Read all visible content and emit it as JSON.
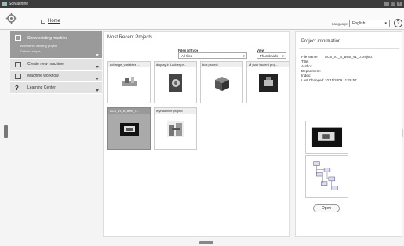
{
  "app": {
    "title": "SoMachine"
  },
  "toolbar": {
    "home_label": "Home",
    "language_label": "Language:",
    "language_value": "English",
    "help_label": "?"
  },
  "sidebar": {
    "active": {
      "label": "Show existing machine",
      "sub1": "Browse for existing project",
      "sub2": "Detect sample"
    },
    "items": [
      {
        "label": "Create new machine"
      },
      {
        "label": "Machine workflow"
      },
      {
        "label": "Learning Center"
      }
    ]
  },
  "main": {
    "heading": "Most Recent Projects",
    "files_label": "Files of type",
    "files_value": "All files",
    "view_label": "View",
    "view_value": "Thumbnails",
    "tiles": [
      {
        "label": "echange_variables ..."
      },
      {
        "label": "display in Ladder pr..."
      },
      {
        "label": "box project"
      },
      {
        "label": "M pour laurent proj..."
      },
      {
        "label": "ACS_v1_B_Best_v..."
      },
      {
        "label": "mymachine project"
      }
    ]
  },
  "info": {
    "title": "Project Information",
    "rows": [
      {
        "k": "File Name:",
        "v": "ACS_v1_B_Best_v1_0.project"
      },
      {
        "k": "Title:",
        "v": ""
      },
      {
        "k": "Author:",
        "v": ""
      },
      {
        "k": "Department:",
        "v": ""
      },
      {
        "k": "Index:",
        "v": ""
      },
      {
        "k": "Last Changed:",
        "v": "10/11/2009 11:29:57"
      }
    ],
    "open_label": "Open"
  },
  "colors": {
    "titlebar": "#3c3c3c",
    "sidebar_active": "#9a9a9a",
    "selected_tile": "#aaaaaa"
  }
}
